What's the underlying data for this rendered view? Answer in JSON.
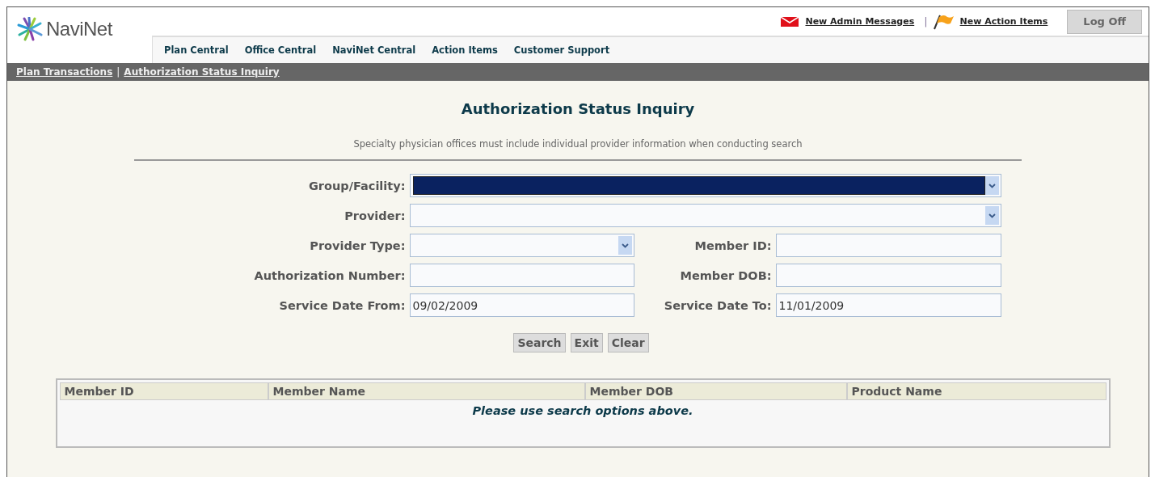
{
  "header": {
    "brand": "NaviNet",
    "links": [
      {
        "kind": "mail",
        "label": "New Admin Messages"
      },
      {
        "kind": "flag",
        "label": "New Action Items"
      }
    ],
    "separator": "|",
    "logoff": "Log Off"
  },
  "nav": [
    "Plan Central",
    "Office Central",
    "NaviNet Central",
    "Action Items",
    "Customer Support"
  ],
  "breadcrumbs": {
    "items": [
      "Plan Transactions",
      "Authorization Status Inquiry"
    ],
    "separator": "|"
  },
  "title": "Authorization Status Inquiry",
  "notice": "Specialty physician offices must include individual provider information when conducting search",
  "form": {
    "rows": [
      [
        {
          "label": "Group/Facility:",
          "kind": "select",
          "focused": true
        }
      ],
      [
        {
          "label": "Provider:",
          "kind": "select",
          "focused": false
        }
      ],
      [
        {
          "label": "Provider Type:",
          "kind": "select",
          "focused": false
        },
        {
          "label": "Member ID:",
          "kind": "text",
          "focused": false
        }
      ],
      [
        {
          "label": "Authorization Number:",
          "kind": "text",
          "focused": false
        },
        {
          "label": "Member DOB:",
          "kind": "text",
          "focused": false
        }
      ],
      [
        {
          "label": "Service Date From:",
          "kind": "text",
          "value": "09/02/2009",
          "focused": false
        },
        {
          "label": "Service Date To:",
          "kind": "text",
          "value": "11/01/2009",
          "focused": false
        }
      ]
    ],
    "buttons": [
      "Search",
      "Exit",
      "Clear"
    ]
  },
  "table": {
    "columns": [
      "Member ID",
      "Member Name",
      "Member DOB",
      "Product Name"
    ],
    "empty_message": "Please use search options above."
  }
}
